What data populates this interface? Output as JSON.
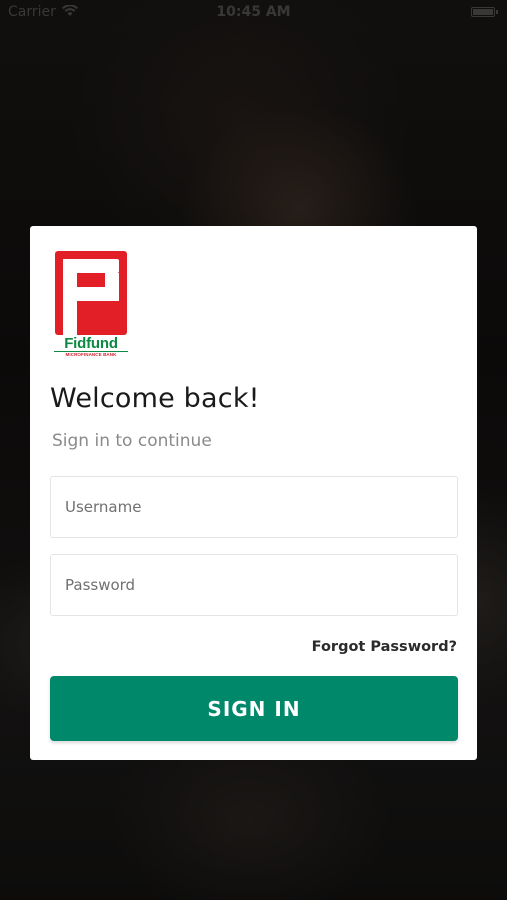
{
  "status_bar": {
    "carrier": "Carrier",
    "time": "10:45 AM"
  },
  "logo": {
    "brand_name": "Fidfund",
    "tagline": "MICROFINANCE BANK"
  },
  "login": {
    "title": "Welcome back!",
    "subtitle": "Sign in to continue",
    "username_placeholder": "Username",
    "password_placeholder": "Password",
    "forgot_password_label": "Forgot Password?",
    "sign_in_label": "SIGN IN"
  },
  "colors": {
    "primary_button": "#00886a",
    "logo_red": "#e21f26",
    "logo_green": "#0c8a43",
    "card_background": "#ffffff"
  }
}
